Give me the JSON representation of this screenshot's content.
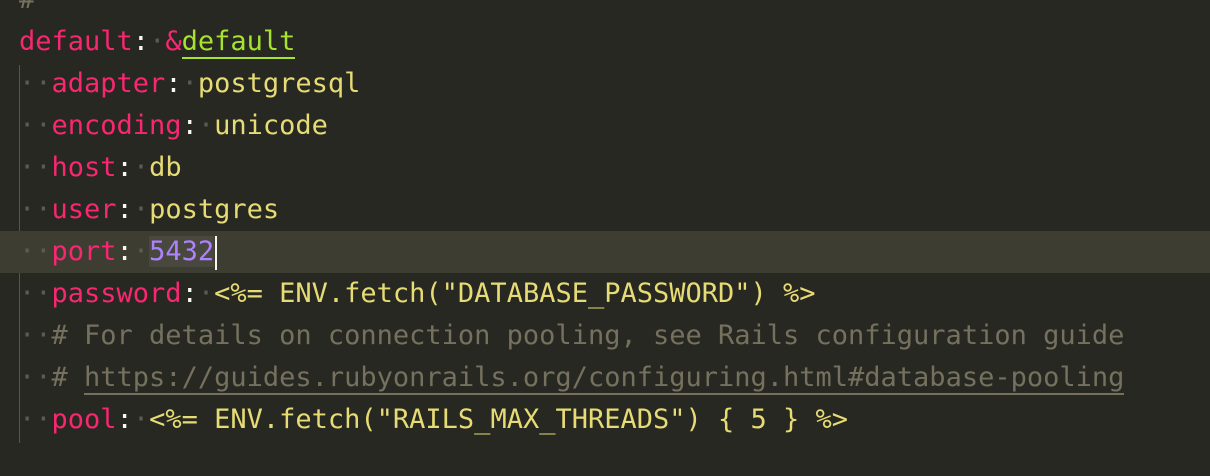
{
  "editor": {
    "lines": [
      {
        "kind": "comment",
        "text": "#"
      },
      {
        "kind": "anchor",
        "key": "default",
        "marker": "&",
        "name": "default"
      },
      {
        "kind": "pair",
        "key": "adapter",
        "value": "postgresql"
      },
      {
        "kind": "pair",
        "key": "encoding",
        "value": "unicode"
      },
      {
        "kind": "pair",
        "key": "host",
        "value": "db"
      },
      {
        "kind": "pair",
        "key": "user",
        "value": "postgres"
      },
      {
        "kind": "pair",
        "key": "port",
        "value": "5432",
        "selected": true,
        "current": true
      },
      {
        "kind": "erb",
        "key": "password",
        "value": "<%= ENV.fetch(\"DATABASE_PASSWORD\") %>"
      },
      {
        "kind": "comment",
        "text": "# For details on connection pooling, see Rails configuration guide"
      },
      {
        "kind": "link-comment",
        "prefix": "# ",
        "url": "https://guides.rubyonrails.org/configuring.html#database-pooling"
      },
      {
        "kind": "erb",
        "key": "pool",
        "value": "<%= ENV.fetch(\"RAILS_MAX_THREADS\") { 5 } %>"
      }
    ],
    "colors": {
      "background": "#272822",
      "current_line": "#3e3d32",
      "key": "#f92672",
      "string": "#e6db74",
      "number": "#ae81ff",
      "anchor": "#a6e22e",
      "comment": "#75715e"
    }
  }
}
